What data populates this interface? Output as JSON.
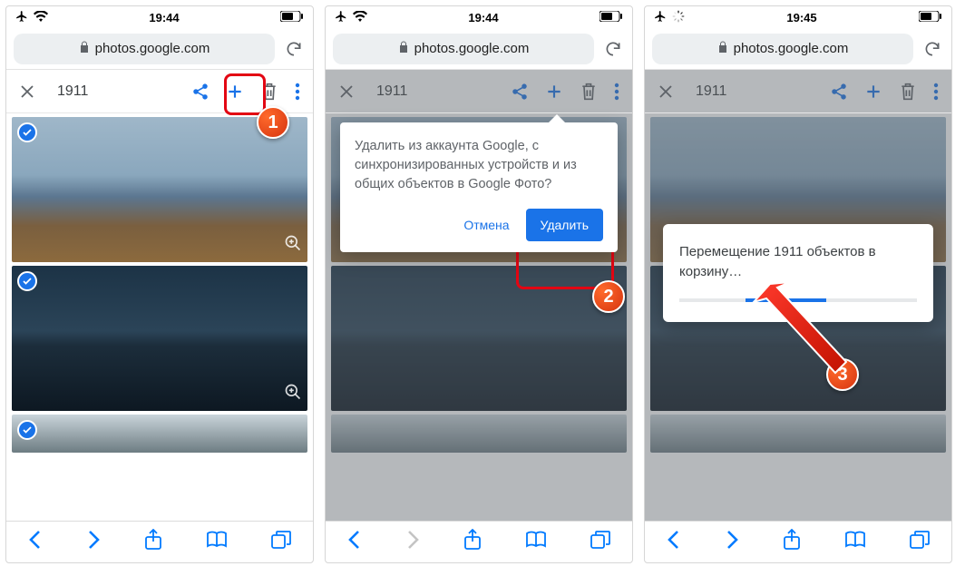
{
  "statusbar": {
    "time1": "19:44",
    "time2": "19:44",
    "time3": "19:45"
  },
  "url": "photos.google.com",
  "selection_count": "1911",
  "dialog": {
    "text": "Удалить из аккаунта Google, с синхронизированных устройств и из общих объектов в Google Фото?",
    "cancel": "Отмена",
    "confirm": "Удалить"
  },
  "progress": {
    "text": "Перемещение 1911 объектов в корзину…"
  },
  "badges": {
    "one": "1",
    "two": "2",
    "three": "3"
  }
}
